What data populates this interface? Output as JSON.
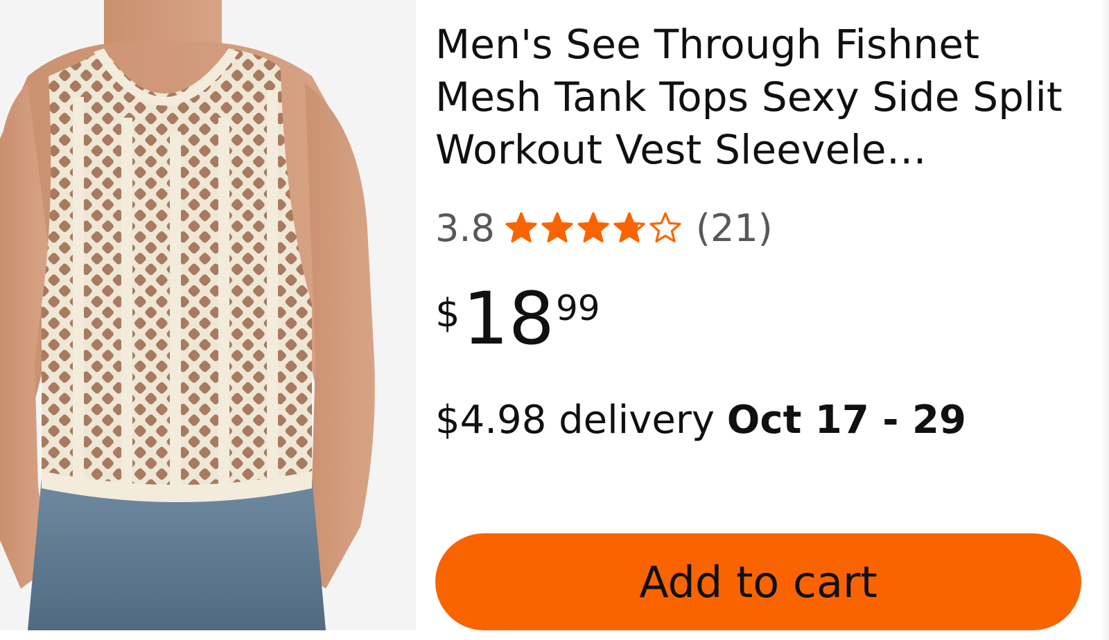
{
  "product": {
    "title": "Men's See Through Fishnet Mesh Tank Tops Sexy Side Split Workout Vest Sleevele…",
    "image_alt": "fishnet-mesh-tank-top-photo"
  },
  "rating": {
    "value": "3.8",
    "stars": 3.8,
    "max_stars": 5,
    "count": "(21)",
    "star_color": "#fa6400"
  },
  "price": {
    "symbol": "$",
    "whole": "18",
    "fraction": "99"
  },
  "delivery": {
    "text": "$4.98 delivery ",
    "date": "Oct 17 - 29"
  },
  "actions": {
    "add_to_cart_label": "Add to cart",
    "button_color": "#fa6400"
  }
}
